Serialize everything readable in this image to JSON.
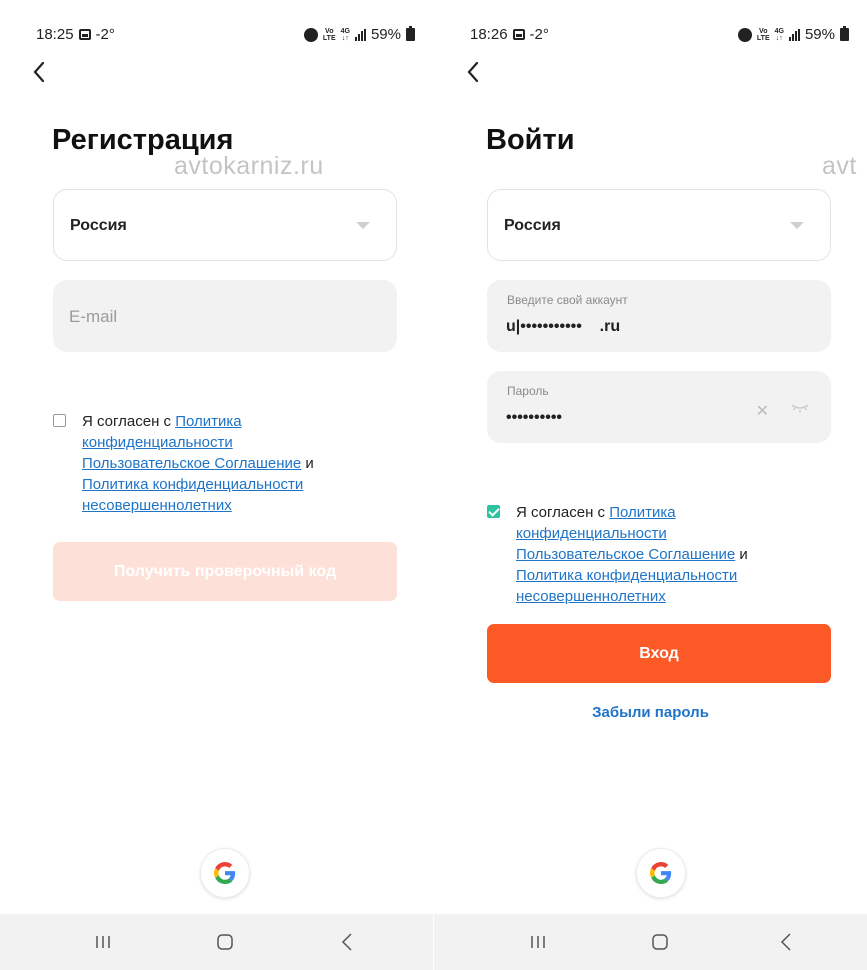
{
  "left": {
    "status": {
      "time": "18:25",
      "temp": "-2°",
      "battery": "59%"
    },
    "title": "Регистрация",
    "watermark": "avtokarniz.ru",
    "country": "Россия",
    "email_placeholder": "E-mail",
    "agreement": {
      "checked": false,
      "prefix": "Я согласен с ",
      "link1": "Политика конфиденциальности",
      "link2": "Пользовательское Соглашение",
      "conj": " и ",
      "link3": "Политика конфиденциальности несовершеннолетних"
    },
    "button": "Получить проверочный код"
  },
  "right": {
    "status": {
      "time": "18:26",
      "temp": "-2°",
      "battery": "59%"
    },
    "title": "Войти",
    "watermark": "avt",
    "country": "Россия",
    "account": {
      "label": "Введите свой аккаунт",
      "value": "u|•••••••••••    .ru"
    },
    "password": {
      "label": "Пароль",
      "value": "••••••••••"
    },
    "agreement": {
      "checked": true,
      "prefix": "Я согласен с ",
      "link1": "Политика конфиденциальности",
      "link2": "Пользовательское Соглашение",
      "conj": " и ",
      "link3": "Политика конфиденциальности несовершеннолетних"
    },
    "button": "Вход",
    "forgot": "Забыли пароль"
  },
  "status_icons": [
    "image-icon",
    "alarm-icon",
    "volte-lte-icon",
    "4g-icon",
    "signal-icon",
    "battery-icon"
  ],
  "colors": {
    "accent": "#fb5a27",
    "accent_disabled": "#fde0d8",
    "link": "#1f74c7",
    "checkbox_checked": "#2bc3a0",
    "field_bg": "#f2f2f2"
  }
}
